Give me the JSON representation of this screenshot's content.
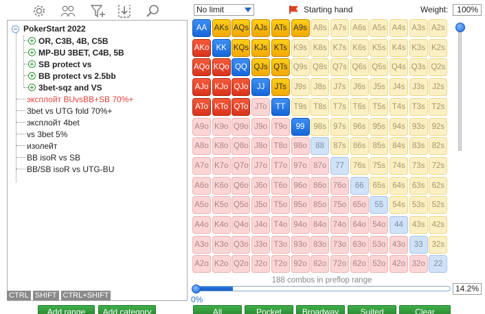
{
  "toolbar": {
    "icons": [
      "gear-icon",
      "users-icon",
      "filter-plus-icon",
      "import-icon",
      "search-icon"
    ]
  },
  "tree": {
    "root": {
      "label": "PokerStart 2022"
    },
    "subcategories": [
      {
        "label": "OR, C3B, 4B, C5B"
      },
      {
        "label": "MP-BU 3BET, C4B, 5B"
      },
      {
        "label": "SB protect vs"
      },
      {
        "label": "BB protect vs 2.5bb"
      },
      {
        "label": "3bet-sqz and VS"
      }
    ],
    "leaves": [
      {
        "label": "эксплойт BUvsBB+SB 70%+",
        "highlight": true
      },
      {
        "label": "3bet vs UTG fold 70%+",
        "highlight": false
      },
      {
        "label": "эксплойт 4bet",
        "highlight": false
      },
      {
        "label": "vs 3bet 5%",
        "highlight": false
      },
      {
        "label": "изолейт",
        "highlight": false
      },
      {
        "label": "BB isoR vs SB",
        "highlight": false
      },
      {
        "label": "BB/SB isoR vs UTG-BU",
        "highlight": false
      }
    ]
  },
  "keys": {
    "ctrl": "CTRL",
    "shift": "SHIFT",
    "ctrl_shift": "CTRL+SHIFT"
  },
  "buttons": {
    "add_range": "Add range",
    "add_category": "Add category",
    "all": "All",
    "pocket": "Pocket",
    "broadway": "Broadway",
    "suited": "Suited",
    "clear": "Clear"
  },
  "header": {
    "limit_select": "No limit",
    "starting_hand": "Starting hand",
    "weight_label": "Weight:",
    "weight_value": "100%"
  },
  "range": {
    "ranks": [
      "A",
      "K",
      "Q",
      "J",
      "T",
      "9",
      "8",
      "7",
      "6",
      "5",
      "4",
      "3",
      "2"
    ],
    "selected": [
      "AA",
      "AKs",
      "AQs",
      "AJs",
      "ATs",
      "A9s",
      "AKo",
      "KK",
      "KQs",
      "KJs",
      "KTs",
      "AQo",
      "KQo",
      "QQ",
      "QJs",
      "QTs",
      "AJo",
      "KJo",
      "QJo",
      "JJ",
      "JTs",
      "ATo",
      "KTo",
      "QTo",
      "TT",
      "99"
    ],
    "combos_text": "188 combos in preflop range",
    "percent": "14.2%",
    "slider_min_label": "0%",
    "slider_fraction": 0.142
  },
  "colors": {
    "pair_selected": "#1f6fe0",
    "suited_selected": "#f5b400",
    "offsuit_selected": "#e2401f",
    "pair_unselected": "#cfe2f7",
    "suited_unselected": "#fbf0c3",
    "offsuit_unselected": "#fcd6d6",
    "button_green": "#2f9a3a"
  }
}
